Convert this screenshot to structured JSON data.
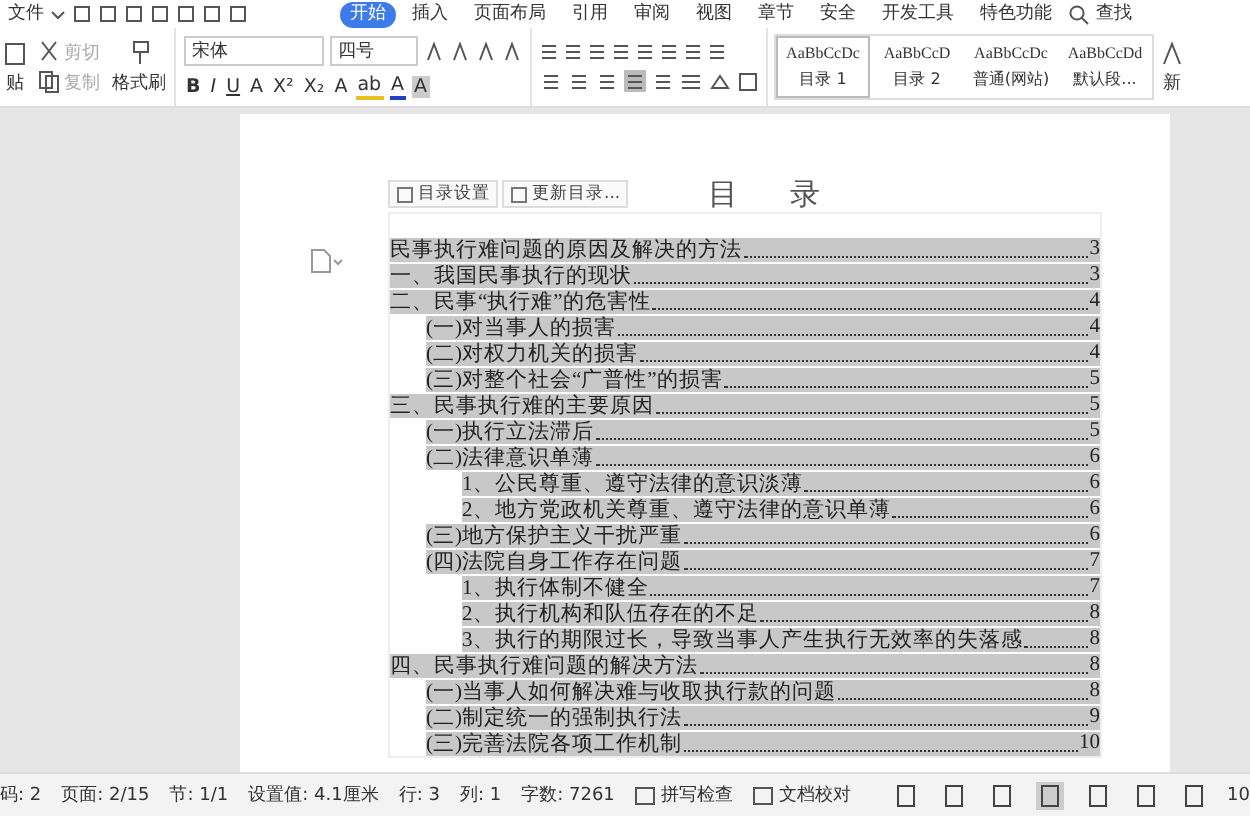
{
  "menu": {
    "file": "文件",
    "tabs": [
      {
        "label": "开始",
        "selected": true
      },
      {
        "label": "插入",
        "selected": false
      },
      {
        "label": "页面布局",
        "selected": false
      },
      {
        "label": "引用",
        "selected": false
      },
      {
        "label": "审阅",
        "selected": false
      },
      {
        "label": "视图",
        "selected": false
      },
      {
        "label": "章节",
        "selected": false
      },
      {
        "label": "安全",
        "selected": false
      },
      {
        "label": "开发工具",
        "selected": false
      },
      {
        "label": "特色功能",
        "selected": false
      }
    ],
    "search": "查找"
  },
  "ribbon": {
    "clipboard": [
      {
        "kind": "paste",
        "label": "贴",
        "disabled": false
      },
      {
        "kind": "cut",
        "label": "剪切",
        "disabled": true
      },
      {
        "kind": "copy",
        "label": "复制",
        "disabled": true
      },
      {
        "kind": "painter",
        "label": "格式刷",
        "disabled": false
      }
    ],
    "font": {
      "name": "宋体",
      "size": "四号"
    },
    "format": [
      "B",
      "I",
      "U",
      "A",
      "X²",
      "X₂",
      "A",
      "ab",
      "A",
      "A"
    ],
    "align": [
      {
        "selected": false
      },
      {
        "selected": false
      },
      {
        "selected": false
      },
      {
        "selected": true
      },
      {
        "selected": false
      }
    ],
    "styles": [
      {
        "preview": "AaBbCcDc",
        "name": "目录 1",
        "selected": true
      },
      {
        "preview": "AaBbCcD",
        "name": "目录 2",
        "selected": false
      },
      {
        "preview": "AaBbCcDc",
        "name": "普通(网站)",
        "selected": false
      },
      {
        "preview": "AaBbCcDd",
        "name": "默认段...",
        "selected": false
      }
    ],
    "new_style": "新"
  },
  "page": {
    "title": "目 录",
    "toc_buttons": [
      "目录设置",
      "更新目录..."
    ],
    "toc": [
      {
        "text": "民事执行难问题的原因及解决的方法",
        "page": "3"
      },
      {
        "text": "一、我国民事执行的现状",
        "page": "3"
      },
      {
        "text": "二、民事“执行难”的危害性",
        "page": "4",
        "children": [
          {
            "text": "(一)对当事人的损害",
            "page": "4"
          },
          {
            "text": "(二)对权力机关的损害",
            "page": "4"
          },
          {
            "text": "(三)对整个社会“广普性”的损害",
            "page": "5"
          }
        ]
      },
      {
        "text": "三、民事执行难的主要原因",
        "page": "5",
        "children": [
          {
            "text": "(一)执行立法滞后",
            "page": "5"
          },
          {
            "text": "(二)法律意识单薄",
            "page": "6",
            "children": [
              {
                "text": "1、公民尊重、遵守法律的意识淡薄",
                "page": "6"
              },
              {
                "text": "2、地方党政机关尊重、遵守法律的意识单薄",
                "page": "6"
              }
            ]
          },
          {
            "text": "(三)地方保护主义干扰严重",
            "page": "6"
          },
          {
            "text": "(四)法院自身工作存在问题",
            "page": "7",
            "children": [
              {
                "text": "1、执行体制不健全",
                "page": "7"
              },
              {
                "text": "2、执行机构和队伍存在的不足",
                "page": "8"
              },
              {
                "text": "3、执行的期限过长，导致当事人产生执行无效率的失落感",
                "page": "8"
              }
            ]
          }
        ]
      },
      {
        "text": "四、民事执行难问题的解决方法",
        "page": "8",
        "children": [
          {
            "text": "(一)当事人如何解决难与收取执行款的问题",
            "page": "8"
          },
          {
            "text": "(二)制定统一的强制执行法",
            "page": "9"
          },
          {
            "text": "(三)完善法院各项工作机制",
            "page": "10"
          }
        ]
      }
    ]
  },
  "status": [
    "码: 2",
    "页面: 2/15",
    "节: 1/1",
    "设置值: 4.1厘米",
    "行: 3",
    "列: 1",
    "字数: 7261"
  ],
  "status_buttons": [
    "拼写检查",
    "文档校对"
  ],
  "zoom": "10"
}
